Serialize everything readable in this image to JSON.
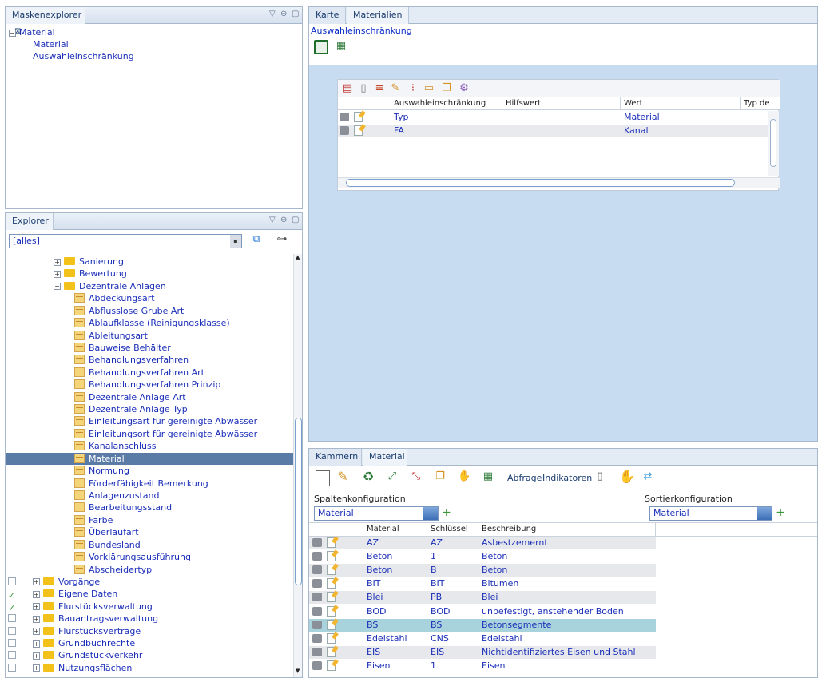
{
  "maskenexplorer": {
    "title": "Maskenexplorer",
    "close": "⊠",
    "tree": {
      "root": "Material",
      "items": [
        "Material",
        "Auswahleinschränkung"
      ]
    }
  },
  "explorer": {
    "title": "Explorer",
    "filter_value": "[alles]",
    "tree": [
      {
        "label": "Sanierung",
        "type": "folder",
        "level": 1
      },
      {
        "label": "Bewertung",
        "type": "folder",
        "level": 1
      },
      {
        "label": "Dezentrale Anlagen",
        "type": "folder-open",
        "level": 1
      },
      {
        "label": "Abdeckungsart",
        "type": "table",
        "level": 2
      },
      {
        "label": "Abflusslose Grube Art",
        "type": "table",
        "level": 2
      },
      {
        "label": "Ablaufklasse (Reinigungsklasse)",
        "type": "table",
        "level": 2
      },
      {
        "label": "Ableitungsart",
        "type": "table",
        "level": 2
      },
      {
        "label": "Bauweise Behälter",
        "type": "table",
        "level": 2
      },
      {
        "label": "Behandlungsverfahren",
        "type": "table",
        "level": 2
      },
      {
        "label": "Behandlungsverfahren Art",
        "type": "table",
        "level": 2
      },
      {
        "label": "Behandlungsverfahren Prinzip",
        "type": "table",
        "level": 2
      },
      {
        "label": "Dezentrale Anlage Art",
        "type": "table",
        "level": 2
      },
      {
        "label": "Dezentrale Anlage Typ",
        "type": "table",
        "level": 2
      },
      {
        "label": "Einleitungsart für gereinigte Abwässer",
        "type": "table",
        "level": 2
      },
      {
        "label": "Einleitungsort für gereinigte Abwässer",
        "type": "table",
        "level": 2
      },
      {
        "label": "Kanalanschluss",
        "type": "table",
        "level": 2
      },
      {
        "label": "Material",
        "type": "table",
        "level": 2,
        "selected": true
      },
      {
        "label": "Normung",
        "type": "table",
        "level": 2
      },
      {
        "label": "Förderfähigkeit Bemerkung",
        "type": "table",
        "level": 2
      },
      {
        "label": "Anlagenzustand",
        "type": "table",
        "level": 2
      },
      {
        "label": "Bearbeitungsstand",
        "type": "table",
        "level": 2
      },
      {
        "label": "Farbe",
        "type": "table",
        "level": 2
      },
      {
        "label": "Überlaufart",
        "type": "table",
        "level": 2
      },
      {
        "label": "Bundesland",
        "type": "table",
        "level": 2
      },
      {
        "label": "Vorklärungsausführung",
        "type": "table",
        "level": 2
      },
      {
        "label": "Abscheidertyp",
        "type": "table",
        "level": 2
      },
      {
        "label": "Vorgänge",
        "type": "folder",
        "level": 0,
        "checked": false
      },
      {
        "label": "Eigene Daten",
        "type": "folder",
        "level": 0,
        "checked": true
      },
      {
        "label": "Flurstücksverwaltung",
        "type": "folder",
        "level": 0,
        "checked": true
      },
      {
        "label": "Bauantragsverwaltung",
        "type": "folder",
        "level": 0,
        "checked": false
      },
      {
        "label": "Flurstücksverträge",
        "type": "folder",
        "level": 0,
        "checked": false
      },
      {
        "label": "Grundbuchrechte",
        "type": "folder",
        "level": 0,
        "checked": false
      },
      {
        "label": "Grundstückverkehr",
        "type": "folder",
        "level": 0,
        "checked": false
      },
      {
        "label": "Nutzungsflächen",
        "type": "folder",
        "level": 0,
        "checked": false
      }
    ]
  },
  "editor": {
    "tabs": [
      "Karte",
      "Materialien"
    ],
    "section_title": "Auswahleinschränkung",
    "table": {
      "columns": [
        "Auswahleinschränkung",
        "Hilfswert",
        "Wert",
        "Typ de"
      ],
      "rows": [
        {
          "a": "Typ",
          "h": "",
          "w": "Material"
        },
        {
          "a": "FA",
          "h": "",
          "w": "Kanal"
        }
      ]
    }
  },
  "bottom": {
    "tabs": [
      "Kammern",
      "Material"
    ],
    "toolbar": {
      "abfrage": "Abfrage",
      "indikatoren": "Indikatoren"
    },
    "spalten_label": "Spaltenkonfiguration",
    "spalten_value": "Material",
    "sortier_label": "Sortierkonfiguration",
    "sortier_value": "Material",
    "columns": [
      "Material",
      "Schlüssel",
      "Beschreibung"
    ],
    "rows": [
      {
        "m": "AZ",
        "s": "AZ",
        "b": "Asbestzemernt"
      },
      {
        "m": "Beton",
        "s": "1",
        "b": "Beton"
      },
      {
        "m": "Beton",
        "s": "B",
        "b": "Beton"
      },
      {
        "m": "BIT",
        "s": "BIT",
        "b": "Bitumen"
      },
      {
        "m": "Blei",
        "s": "PB",
        "b": "Blei"
      },
      {
        "m": "BOD",
        "s": "BOD",
        "b": "unbefestigt, anstehender Boden"
      },
      {
        "m": "BS",
        "s": "BS",
        "b": "Betonsegmente",
        "selected": true
      },
      {
        "m": "Edelstahl",
        "s": "CNS",
        "b": "Edelstahl"
      },
      {
        "m": "EIS",
        "s": "EIS",
        "b": "Nichtidentifiziertes Eisen und Stahl"
      },
      {
        "m": "Eisen",
        "s": "1",
        "b": "Eisen"
      }
    ]
  }
}
